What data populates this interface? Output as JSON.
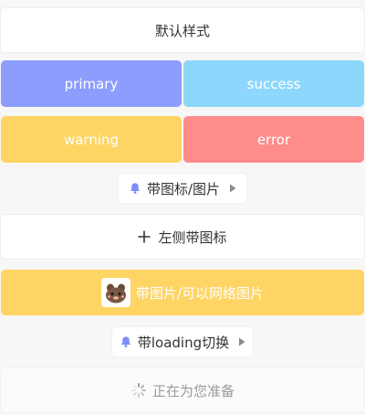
{
  "buttons": {
    "default_label": "默认样式",
    "primary_label": "primary",
    "success_label": "success",
    "warning_label": "warning",
    "error_label": "error",
    "icon_image_label": "带图标/图片",
    "left_icon_label": "左侧带图标",
    "network_image_label": "带图片/可以网络图片",
    "loading_toggle_label": "带loading切换",
    "loading_label": "正在为您准备"
  },
  "icons": {
    "bell": "bell-icon",
    "arrow": "arrow-right-icon",
    "plus": "plus-icon",
    "avatar": "cartoon-avatar-icon",
    "spinner": "loading-spinner-icon"
  },
  "colors": {
    "primary": "#8c9dfe",
    "success": "#8dd7fc",
    "warning": "#fed465",
    "error": "#fe8c8b",
    "icon_accent": "#7b8dfb"
  }
}
